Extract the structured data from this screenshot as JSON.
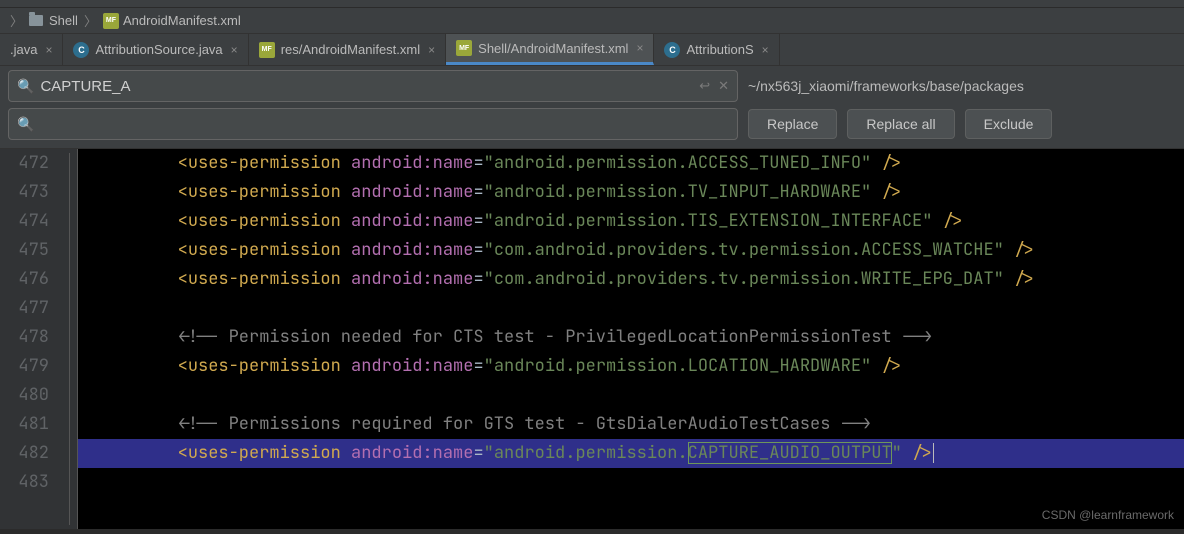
{
  "breadcrumb": {
    "folder": "Shell",
    "file": "AndroidManifest.xml"
  },
  "tabs": [
    {
      "label": ".java",
      "icon": "none",
      "active": false
    },
    {
      "label": "AttributionSource.java",
      "icon": "c",
      "active": false
    },
    {
      "label": "res/AndroidManifest.xml",
      "icon": "mf",
      "active": false
    },
    {
      "label": "Shell/AndroidManifest.xml",
      "icon": "mf",
      "active": true
    },
    {
      "label": "AttributionS",
      "icon": "c",
      "active": false
    }
  ],
  "find": {
    "query": "CAPTURE_A",
    "replace_value": "",
    "path": "~/nx563j_xiaomi/frameworks/base/packages",
    "replace_btn": "Replace",
    "replace_all_btn": "Replace all",
    "exclude_btn": "Exclude"
  },
  "code": {
    "first_line": 472,
    "lines": [
      {
        "n": 472,
        "type": "perm",
        "value": "android.permission.ACCESS_TUNED_INFO"
      },
      {
        "n": 473,
        "type": "perm",
        "value": "android.permission.TV_INPUT_HARDWARE"
      },
      {
        "n": 474,
        "type": "perm",
        "value": "android.permission.TIS_EXTENSION_INTERFACE"
      },
      {
        "n": 475,
        "type": "perm",
        "value": "com.android.providers.tv.permission.ACCESS_WATCHE"
      },
      {
        "n": 476,
        "type": "perm",
        "value": "com.android.providers.tv.permission.WRITE_EPG_DAT"
      },
      {
        "n": 477,
        "type": "blank"
      },
      {
        "n": 478,
        "type": "comment",
        "text": "<!-- Permission needed for CTS test - PrivilegedLocationPermissionTest -->"
      },
      {
        "n": 479,
        "type": "perm",
        "value": "android.permission.LOCATION_HARDWARE"
      },
      {
        "n": 480,
        "type": "blank"
      },
      {
        "n": 481,
        "type": "comment",
        "text": "<!-- Permissions required for GTS test - GtsDialerAudioTestCases -->"
      },
      {
        "n": 482,
        "type": "perm",
        "value_pre": "android.permission.",
        "value_hl": "CAPTURE_AUDIO_OUTPUT",
        "highlight": true,
        "caret": true
      },
      {
        "n": 483,
        "type": "blank"
      }
    ]
  },
  "watermark": "CSDN @learnframework"
}
